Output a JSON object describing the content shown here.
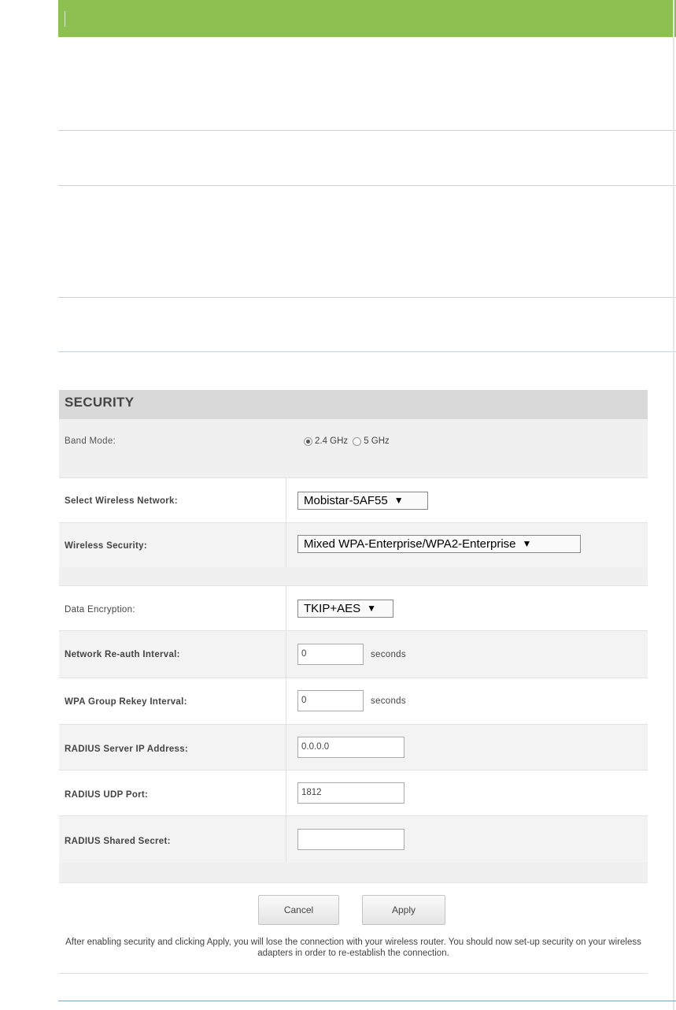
{
  "security": {
    "title": "SECURITY",
    "band_mode": {
      "label": "Band Mode:",
      "options": [
        "2.4 GHz",
        "5 GHz"
      ],
      "selected": "2.4 GHz"
    },
    "wireless_network": {
      "label": "Select Wireless Network:",
      "value": "Mobistar-5AF55"
    },
    "wireless_security": {
      "label": "Wireless Security:",
      "value": "Mixed WPA-Enterprise/WPA2-Enterprise"
    },
    "data_encryption": {
      "label": "Data Encryption:",
      "value": "TKIP+AES"
    },
    "reauth_interval": {
      "label": "Network Re-auth Interval:",
      "value": "0",
      "unit": "seconds"
    },
    "rekey_interval": {
      "label": "WPA Group Rekey Interval:",
      "value": "0",
      "unit": "seconds"
    },
    "radius_ip": {
      "label": "RADIUS Server IP Address:",
      "value": "0.0.0.0"
    },
    "radius_port": {
      "label": "RADIUS UDP Port:",
      "value": "1812"
    },
    "radius_secret": {
      "label": "RADIUS Shared Secret:",
      "value": ""
    },
    "buttons": {
      "cancel": "Cancel",
      "apply": "Apply"
    },
    "note": "After enabling security and clicking Apply, you will lose the connection with your wireless router. You should now set-up security on your wireless adapters in order to re-establish the connection."
  },
  "colors": {
    "header_green": "#8cc152",
    "section_title_bg": "#d9d9d9",
    "row_alt_bg": "#f3f3f3"
  }
}
